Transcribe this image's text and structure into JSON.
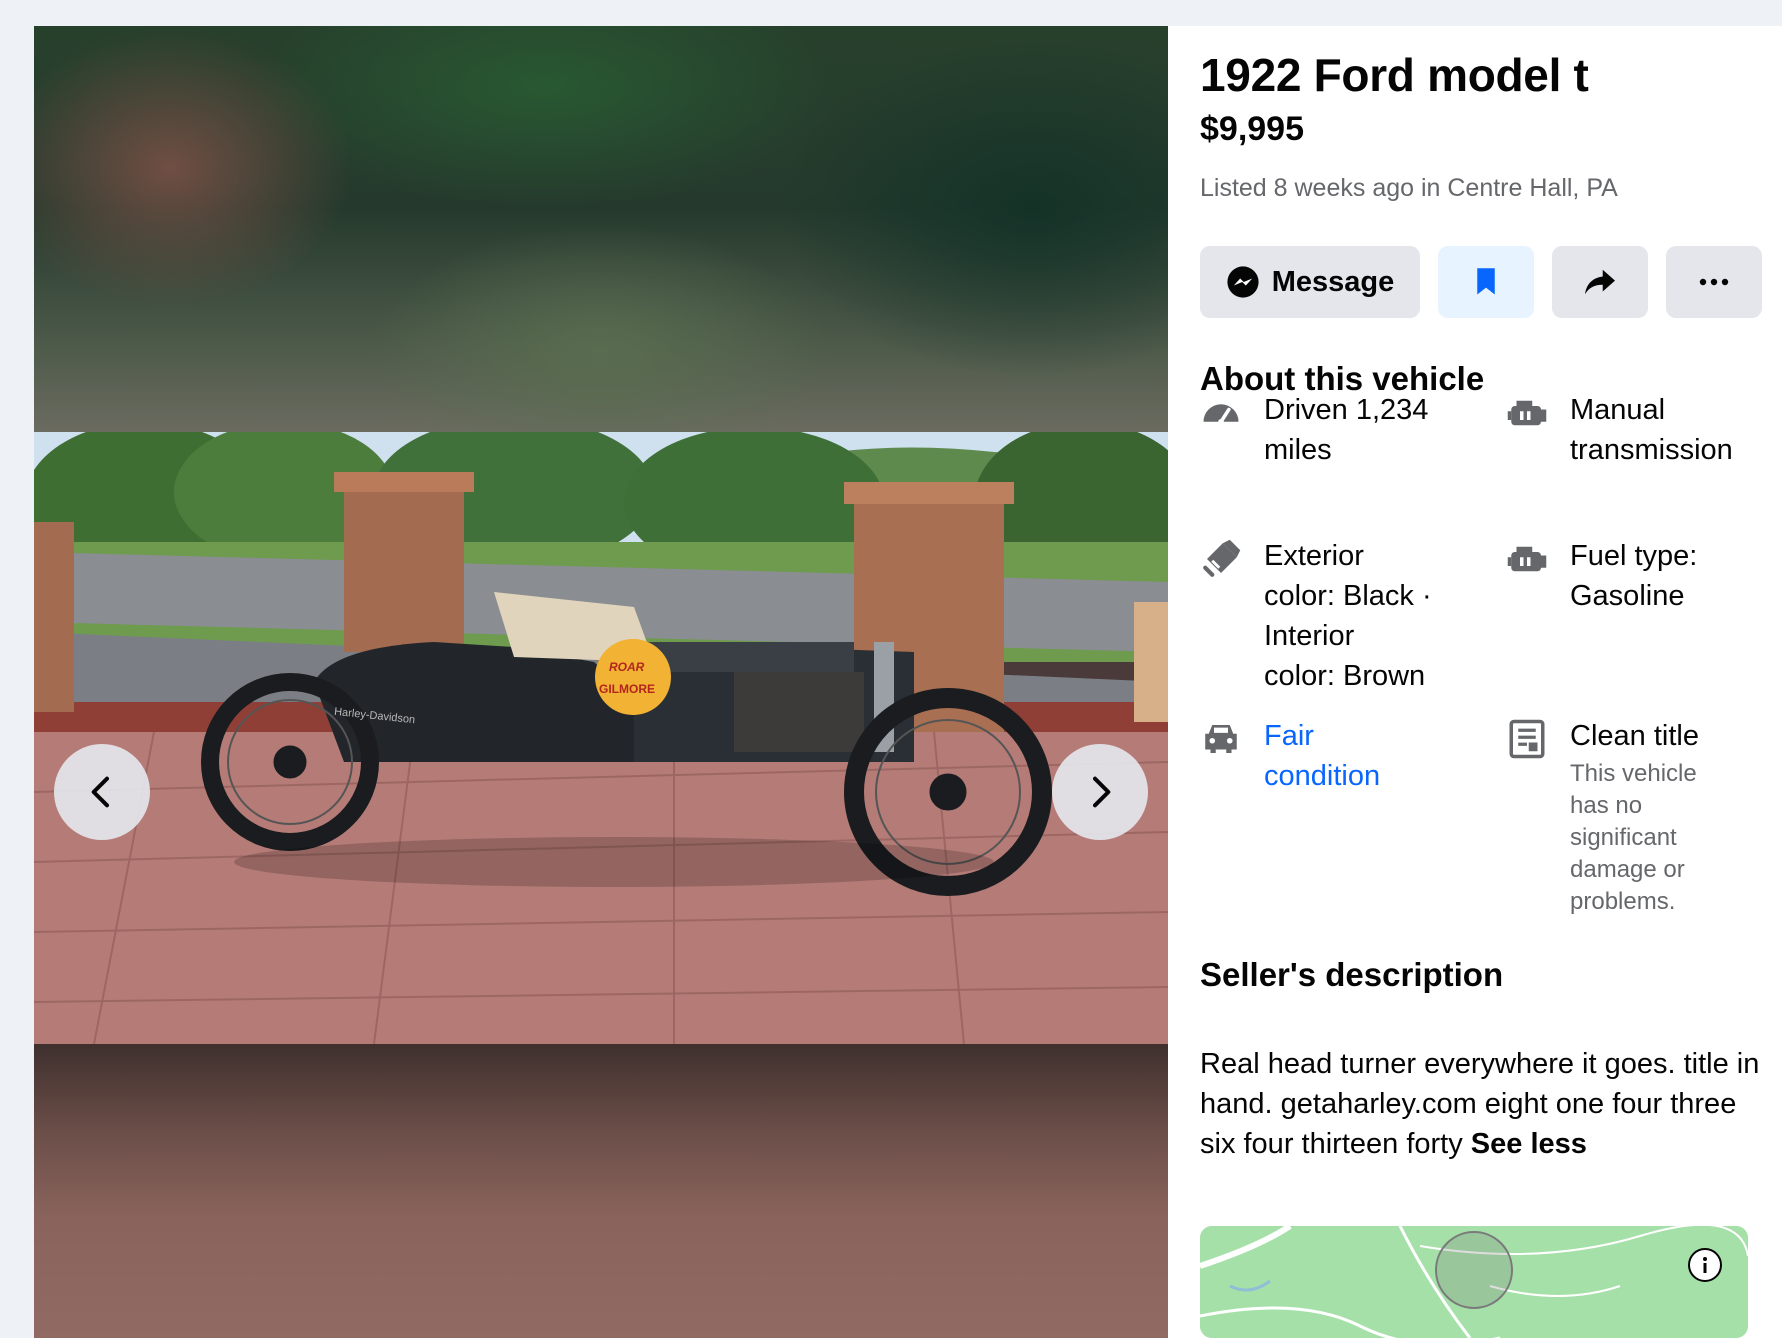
{
  "listing": {
    "title": "1922 Ford model t",
    "price": "$9,995",
    "listed": "Listed 8 weeks ago in Centre Hall, PA"
  },
  "actions": {
    "message_label": "Message",
    "save_icon": "bookmark-icon",
    "share_icon": "share-icon",
    "more_icon": "more-icon",
    "accent_color": "#0866ff"
  },
  "about": {
    "heading": "About this vehicle",
    "specs": [
      {
        "icon": "speedometer-icon",
        "lines": [
          "Driven 1,234",
          "miles"
        ]
      },
      {
        "icon": "transmission-icon",
        "lines": [
          "Manual",
          "transmission"
        ]
      },
      {
        "icon": "paint-icon",
        "lines": [
          "Exterior",
          "color: Black ·",
          "Interior",
          "color: Brown"
        ]
      },
      {
        "icon": "engine-icon",
        "lines": [
          "Fuel type:",
          "Gasoline"
        ]
      },
      {
        "icon": "car-icon",
        "lines": [
          "Fair",
          "condition"
        ]
      },
      {
        "icon": "document-icon",
        "lines": [
          "Clean title"
        ],
        "sub": [
          "This vehicle",
          "has no",
          "significant",
          "damage or",
          "problems."
        ]
      }
    ]
  },
  "seller": {
    "heading": "Seller's description",
    "text": "Real head turner everywhere it goes. title in hand. getaharley.com eight one four three six four thirteen forty ",
    "see_less": "See less"
  },
  "photo": {
    "sticker_top": "ROAR",
    "sticker_bottom": "GILMORE",
    "side_text": "Harley-Davidson"
  },
  "viewer": {
    "prev_icon": "chevron-left-icon",
    "next_icon": "chevron-right-icon"
  },
  "map": {
    "info_icon": "info-icon"
  }
}
